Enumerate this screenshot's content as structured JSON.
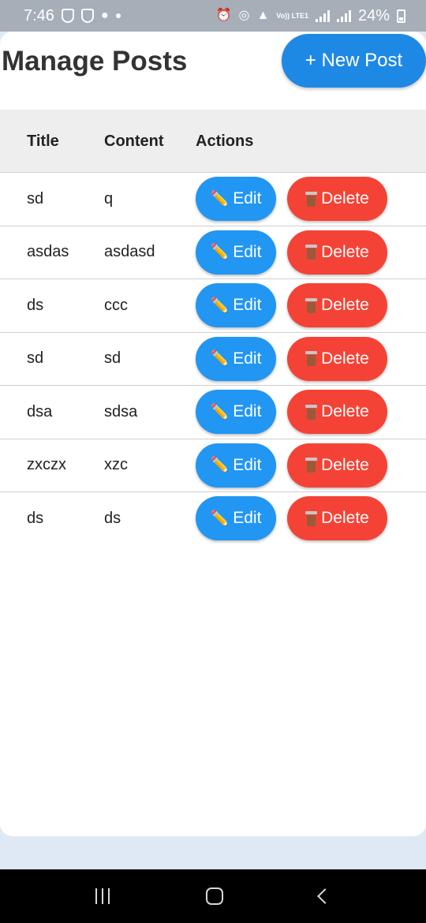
{
  "status_bar": {
    "time": "7:46",
    "lte_label": "Vo)) LTE1",
    "battery": "24%"
  },
  "header": {
    "title": "Manage Posts",
    "new_post_label": "+ New Post"
  },
  "table": {
    "columns": [
      "Title",
      "Content",
      "Actions"
    ],
    "rows": [
      {
        "title": "sd",
        "content": "q"
      },
      {
        "title": "asdas",
        "content": "asdasd"
      },
      {
        "title": "ds",
        "content": "ccc"
      },
      {
        "title": "sd",
        "content": "sd"
      },
      {
        "title": "dsa",
        "content": "sdsa"
      },
      {
        "title": "zxczx",
        "content": "xzc"
      },
      {
        "title": "ds",
        "content": "ds"
      }
    ],
    "edit_label": "Edit",
    "delete_label": "Delete",
    "edit_icon": "pencil-icon",
    "delete_icon": "trash-icon"
  },
  "colors": {
    "primary": "#1e88e5",
    "edit": "#2196f3",
    "delete": "#f44336"
  }
}
